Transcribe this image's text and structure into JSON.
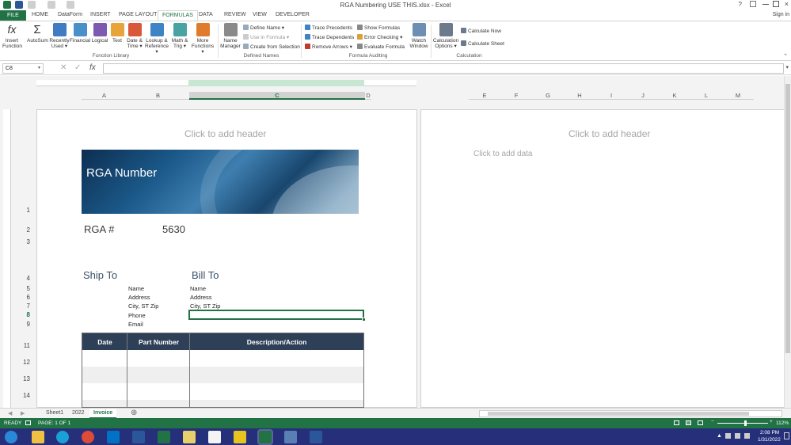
{
  "window": {
    "title": "RGA Numbering USE THIS.xlsx - Excel",
    "help": "?",
    "sign_in": "Sign in"
  },
  "ribbon_tabs": [
    "FILE",
    "HOME",
    "DataForm",
    "INSERT",
    "PAGE LAYOUT",
    "FORMULAS",
    "DATA",
    "REVIEW",
    "VIEW",
    "DEVELOPER"
  ],
  "function_library": {
    "insert_function": [
      "Insert",
      "Function"
    ],
    "autosum": [
      "AutoSum",
      ""
    ],
    "recently_used": [
      "Recently",
      "Used ▾"
    ],
    "financial": [
      "Financial",
      ""
    ],
    "logical": [
      "Logical",
      ""
    ],
    "text": [
      "Text",
      ""
    ],
    "date_time": [
      "Date &",
      "Time ▾"
    ],
    "lookup": [
      "Lookup &",
      "Reference ▾"
    ],
    "math": [
      "Math &",
      "Trig ▾"
    ],
    "more": [
      "More",
      "Functions ▾"
    ],
    "group": "Function Library"
  },
  "defined_names": {
    "name_manager": [
      "Name",
      "Manager"
    ],
    "define_name": "Define Name ▾",
    "use_in_formula": "Use in Formula ▾",
    "create_from_selection": "Create from Selection",
    "group": "Defined Names"
  },
  "formula_auditing": {
    "trace_precedents": "Trace Precedents",
    "trace_dependents": "Trace Dependents",
    "remove_arrows": "Remove Arrows ▾",
    "show_formulas": "Show Formulas",
    "error_checking": "Error Checking ▾",
    "evaluate_formula": "Evaluate Formula",
    "watch_window": [
      "Watch",
      "Window"
    ],
    "group": "Formula Auditing"
  },
  "calculation": {
    "options": [
      "Calculation",
      "Options ▾"
    ],
    "calc_now": "Calculate Now",
    "calc_sheet": "Calculate Sheet",
    "group": "Calculation"
  },
  "formula_bar": {
    "name_box": "C8",
    "fx": "fx"
  },
  "column_headers_left": [
    "A",
    "B",
    "C",
    "D"
  ],
  "column_headers_right": [
    "E",
    "F",
    "G",
    "H",
    "I",
    "J",
    "K",
    "L",
    "M"
  ],
  "row_numbers": [
    "1",
    "2",
    "3",
    "4",
    "5",
    "6",
    "7",
    "8",
    "9",
    "11",
    "12",
    "13",
    "14"
  ],
  "page": {
    "header_placeholder": "Click to add header",
    "data_placeholder": "Click to add data"
  },
  "invoice": {
    "banner_title": "RGA Number",
    "rga_label": "RGA #",
    "rga_value": "5630",
    "ship_to": "Ship To",
    "bill_to": "Bill  To",
    "ship_fields": [
      "Name",
      "Address",
      "City, ST Zip",
      "Phone",
      "Email"
    ],
    "bill_fields": [
      "Name",
      "Address",
      "City, ST Zip"
    ],
    "table_headers": [
      "Date",
      "Part Number",
      "Description/Action"
    ]
  },
  "sheet_tabs": [
    "Sheet1",
    "2022",
    "Invoice"
  ],
  "status": {
    "ready": "READY",
    "page": "PAGE: 1 OF 1",
    "zoom": "112%"
  },
  "taskbar": {
    "time": "2:08 PM",
    "date": "1/31/2022"
  },
  "colors": {
    "excel_green": "#217346",
    "table_header": "#2e4057",
    "taskbar": "#26307a"
  }
}
